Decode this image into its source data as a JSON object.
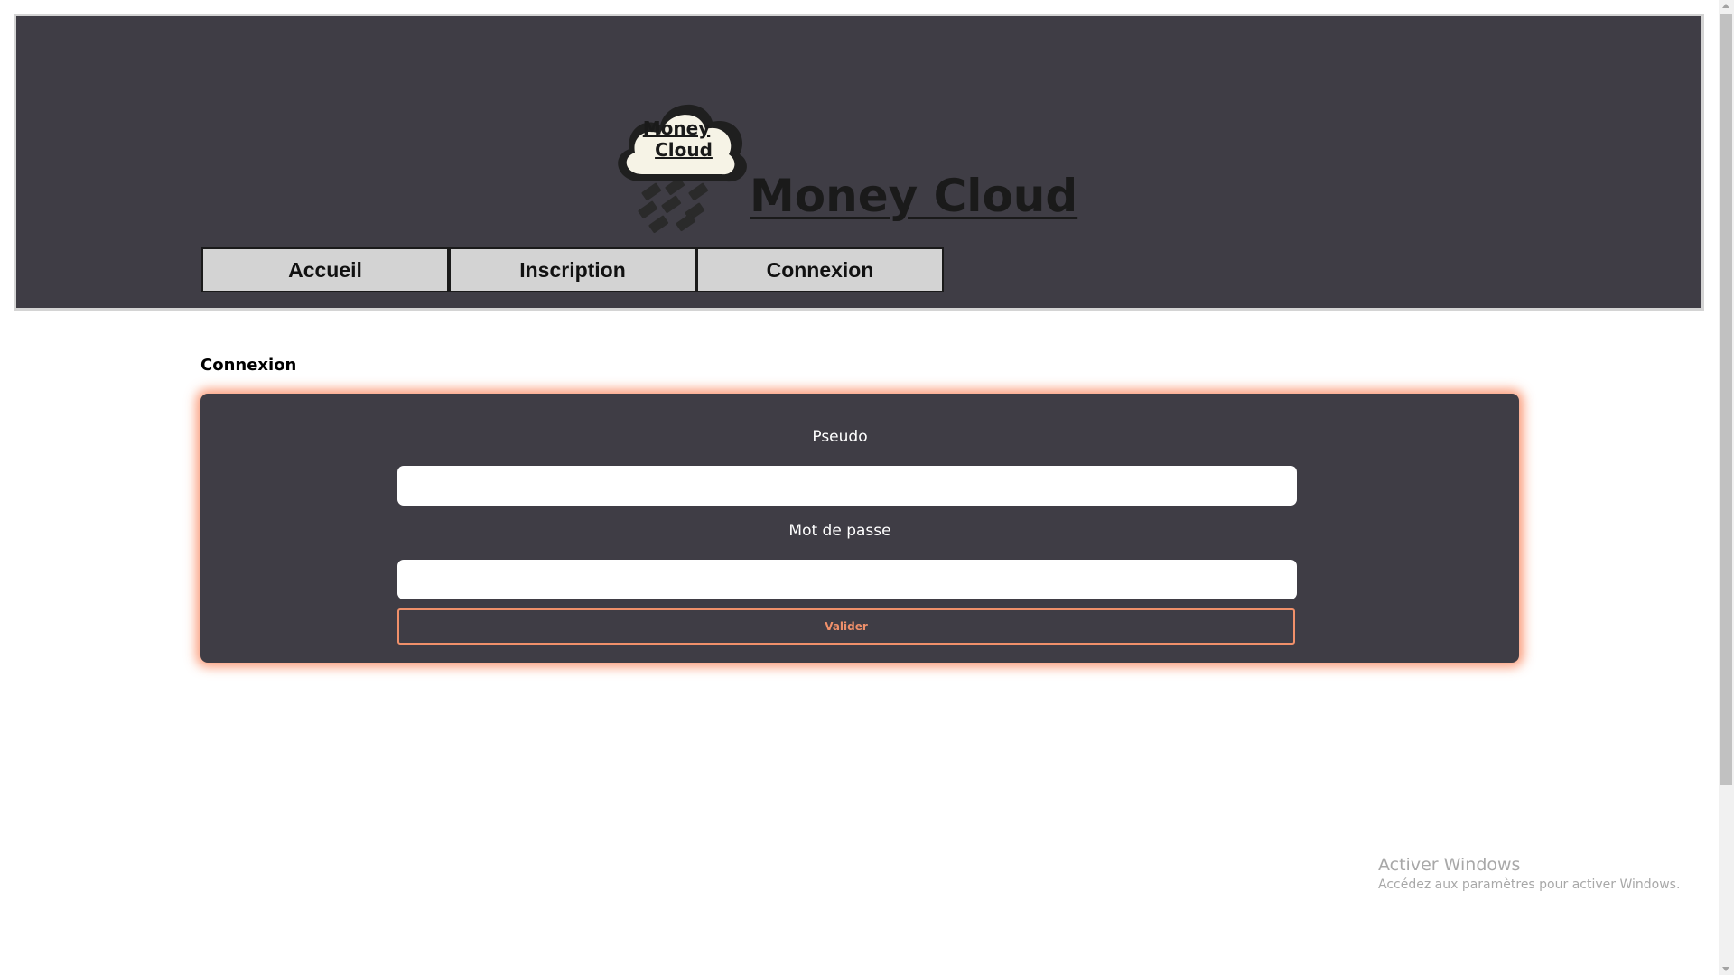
{
  "header": {
    "logo_text_line1": "Money",
    "logo_text_line2": "Cloud",
    "site_title": "Money Cloud"
  },
  "nav": {
    "items": [
      {
        "label": "Accueil"
      },
      {
        "label": "Inscription"
      },
      {
        "label": "Connexion"
      }
    ]
  },
  "main": {
    "section_heading": "Connexion",
    "form": {
      "username_label": "Pseudo",
      "username_value": "",
      "password_label": "Mot de passe",
      "password_value": "",
      "submit_label": "Valider"
    }
  },
  "watermark": {
    "title": "Activer Windows",
    "subtitle": "Accédez aux paramètres pour activer Windows."
  },
  "colors": {
    "header_bg": "#3f3d45",
    "card_glow": "#fa8c64",
    "accent": "#f0906a",
    "nav_bg": "#d3d3d3"
  }
}
